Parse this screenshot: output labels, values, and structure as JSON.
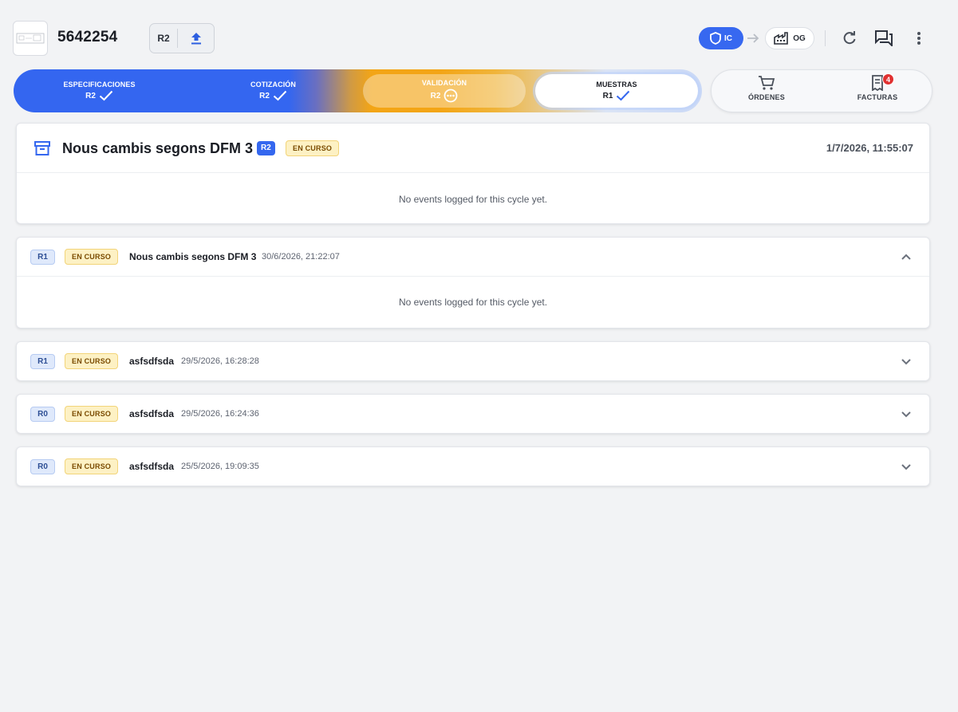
{
  "header": {
    "part_number": "5642254",
    "revision_label": "R2",
    "flow_from": "IC",
    "flow_to": "OG"
  },
  "stepper": {
    "steps": [
      {
        "title": "ESPECIFICACIONES",
        "rev": "R2",
        "state": "done"
      },
      {
        "title": "COTIZACIÓN",
        "rev": "R2",
        "state": "done"
      },
      {
        "title": "VALIDACIÓN",
        "rev": "R2",
        "state": "in-progress"
      },
      {
        "title": "MUESTRAS",
        "rev": "R1",
        "state": "done"
      }
    ]
  },
  "side_nav": {
    "orders_label": "ÓRDENES",
    "invoices_label": "FACTURAS",
    "invoices_badge": "4"
  },
  "current_cycle": {
    "title": "Nous cambis segons DFM 3",
    "rev": "R2",
    "status": "EN CURSO",
    "date": "1/7/2026, 11:55:07",
    "empty_message": "No events logged for this cycle yet."
  },
  "cycles": [
    {
      "rev": "R1",
      "status": "EN CURSO",
      "title": "Nous cambis segons DFM 3",
      "date": "30/6/2026, 21:22:07",
      "expanded": true,
      "empty_message": "No events logged for this cycle yet."
    },
    {
      "rev": "R1",
      "status": "EN CURSO",
      "title": "asfsdfsda",
      "date": "29/5/2026, 16:28:28",
      "expanded": false
    },
    {
      "rev": "R0",
      "status": "EN CURSO",
      "title": "asfsdfsda",
      "date": "29/5/2026, 16:24:36",
      "expanded": false
    },
    {
      "rev": "R0",
      "status": "EN CURSO",
      "title": "asfsdfsda",
      "date": "25/5/2026, 19:09:35",
      "expanded": false
    }
  ],
  "colors": {
    "accent": "#3467ef",
    "warning": "#f3a516",
    "status_bg": "#fdf1c4",
    "badge_red": "#e03131"
  }
}
